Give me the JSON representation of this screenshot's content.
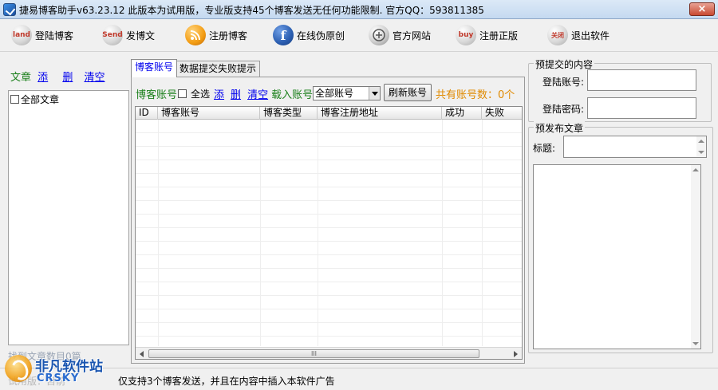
{
  "window": {
    "title": "捷易博客助手v63.23.12    此版本为试用版，专业版支持45个博客发送无任何功能限制.    官方QQ：593811385",
    "close_label": "×"
  },
  "toolbar": {
    "items": [
      {
        "icon": "land-icon",
        "icon_text": "land",
        "label": "登陆博客"
      },
      {
        "icon": "send-icon",
        "icon_text": "Send",
        "label": "发博文"
      },
      {
        "icon": "rss-icon",
        "icon_text": "",
        "label": "注册博客"
      },
      {
        "icon": "facebook-icon",
        "icon_text": "f",
        "label": "在线伪原创"
      },
      {
        "icon": "website-icon",
        "icon_text": "",
        "label": "官方网站"
      },
      {
        "icon": "buy-icon",
        "icon_text": "buy",
        "label": "注册正版"
      },
      {
        "icon": "exit-icon",
        "icon_text": "关闭",
        "label": "退出软件"
      }
    ]
  },
  "left": {
    "articles_label": "文章",
    "add_link": "添",
    "delete_link": "删",
    "clear_link": "清空",
    "tree_root": "全部文章",
    "count_text": "找到文章数目0篇"
  },
  "tabs": [
    {
      "label": "博客账号",
      "active": true
    },
    {
      "label": "数据提交失败提示",
      "active": false
    }
  ],
  "accounts": {
    "label": "博客账号",
    "select_all": "全选",
    "add_link": "添",
    "delete_link": "删",
    "clear_link": "清空",
    "load_label": "载入账号:",
    "load_value": "全部账号",
    "refresh_button": "刷新账号",
    "total_text": "共有账号数：0个",
    "columns": [
      "ID",
      "博客账号",
      "博客类型",
      "博客注册地址",
      "成功",
      "失败"
    ],
    "scroll_thumb_grip": "III"
  },
  "right": {
    "submit_group": "预提交的内容",
    "login_account_label": "登陆账号:",
    "login_password_label": "登陆密码:",
    "publish_group": "预发布文章",
    "title_label": "标题:"
  },
  "status": {
    "prefix": "试用版：目前",
    "text": "仅支持3个博客发送，并且在内容中插入本软件广告"
  },
  "watermark": {
    "cn": "非凡软件站",
    "en": "CRSKY"
  }
}
